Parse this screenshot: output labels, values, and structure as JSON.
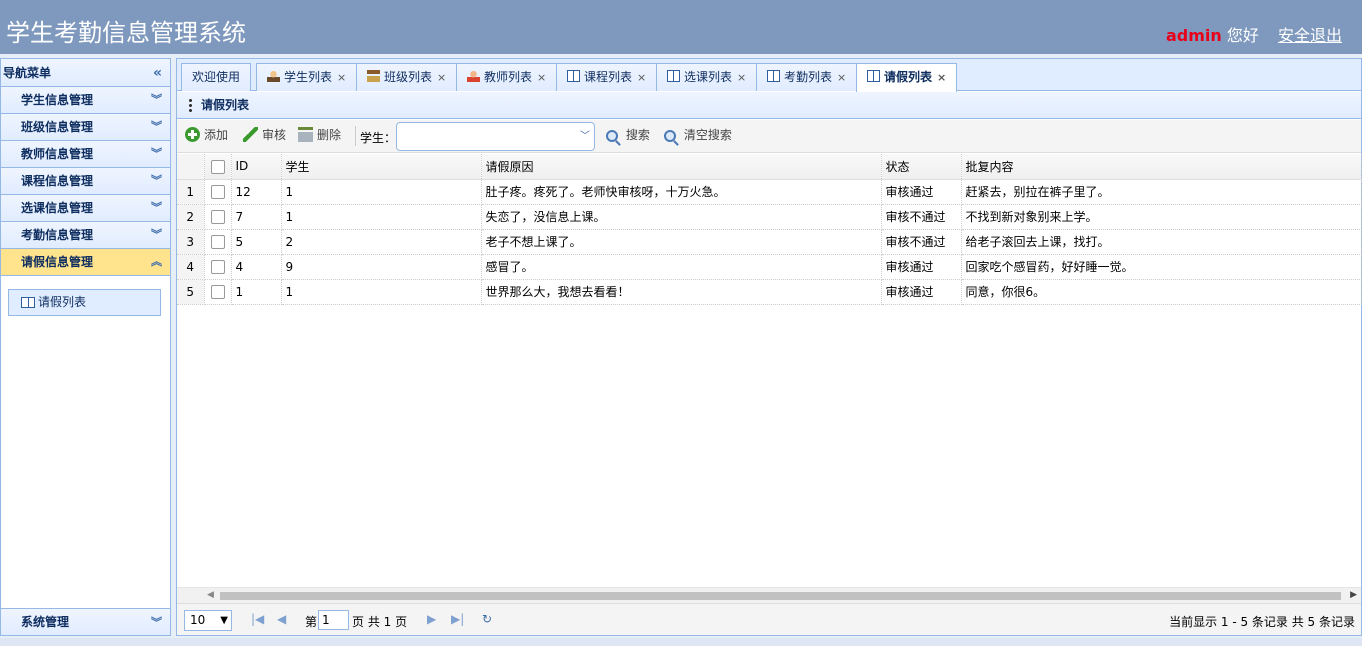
{
  "header": {
    "title": "学生考勤信息管理系统",
    "username": "admin",
    "greeting": "您好",
    "logout": "安全退出"
  },
  "sidebar": {
    "title": "导航菜单",
    "menus": [
      {
        "label": "学生信息管理"
      },
      {
        "label": "班级信息管理"
      },
      {
        "label": "教师信息管理"
      },
      {
        "label": "课程信息管理"
      },
      {
        "label": "选课信息管理"
      },
      {
        "label": "考勤信息管理"
      },
      {
        "label": "请假信息管理"
      }
    ],
    "sub_item": "请假列表",
    "bottom_menu": "系统管理"
  },
  "tabs": [
    {
      "label": "欢迎使用",
      "icon": "none"
    },
    {
      "label": "学生列表",
      "icon": "student-icon"
    },
    {
      "label": "班级列表",
      "icon": "house-icon"
    },
    {
      "label": "教师列表",
      "icon": "teacher-icon"
    },
    {
      "label": "课程列表",
      "icon": "book-icon"
    },
    {
      "label": "选课列表",
      "icon": "book-icon"
    },
    {
      "label": "考勤列表",
      "icon": "book-icon"
    },
    {
      "label": "请假列表",
      "icon": "book-icon",
      "selected": true
    }
  ],
  "panel": {
    "title": "请假列表"
  },
  "toolbar": {
    "add": "添加",
    "audit": "审核",
    "delete": "删除",
    "student_label": "学生：",
    "student_value": "",
    "search": "搜索",
    "clear_search": "清空搜索"
  },
  "grid": {
    "columns": [
      "ID",
      "学生",
      "请假原因",
      "状态",
      "批复内容"
    ],
    "rows": [
      {
        "n": "1",
        "id": "12",
        "student": "1",
        "reason": "肚子疼。疼死了。老师快审核呀，十万火急。",
        "status": "审核通过",
        "reply": "赶紧去，别拉在裤子里了。"
      },
      {
        "n": "2",
        "id": "7",
        "student": "1",
        "reason": "失恋了，没信息上课。",
        "status": "审核不通过",
        "reply": "不找到新对象别来上学。"
      },
      {
        "n": "3",
        "id": "5",
        "student": "2",
        "reason": "老子不想上课了。",
        "status": "审核不通过",
        "reply": "给老子滚回去上课，找打。"
      },
      {
        "n": "4",
        "id": "4",
        "student": "9",
        "reason": "感冒了。",
        "status": "审核通过",
        "reply": "回家吃个感冒药，好好睡一觉。"
      },
      {
        "n": "5",
        "id": "1",
        "student": "1",
        "reason": "世界那么大，我想去看看！",
        "status": "审核通过",
        "reply": "同意，你很6。"
      }
    ]
  },
  "pager": {
    "page_size": "10",
    "page_prefix": "第",
    "page_value": "1",
    "page_suffix": "页 共 1 页",
    "info": "当前显示 1 - 5 条记录 共 5 条记录"
  }
}
